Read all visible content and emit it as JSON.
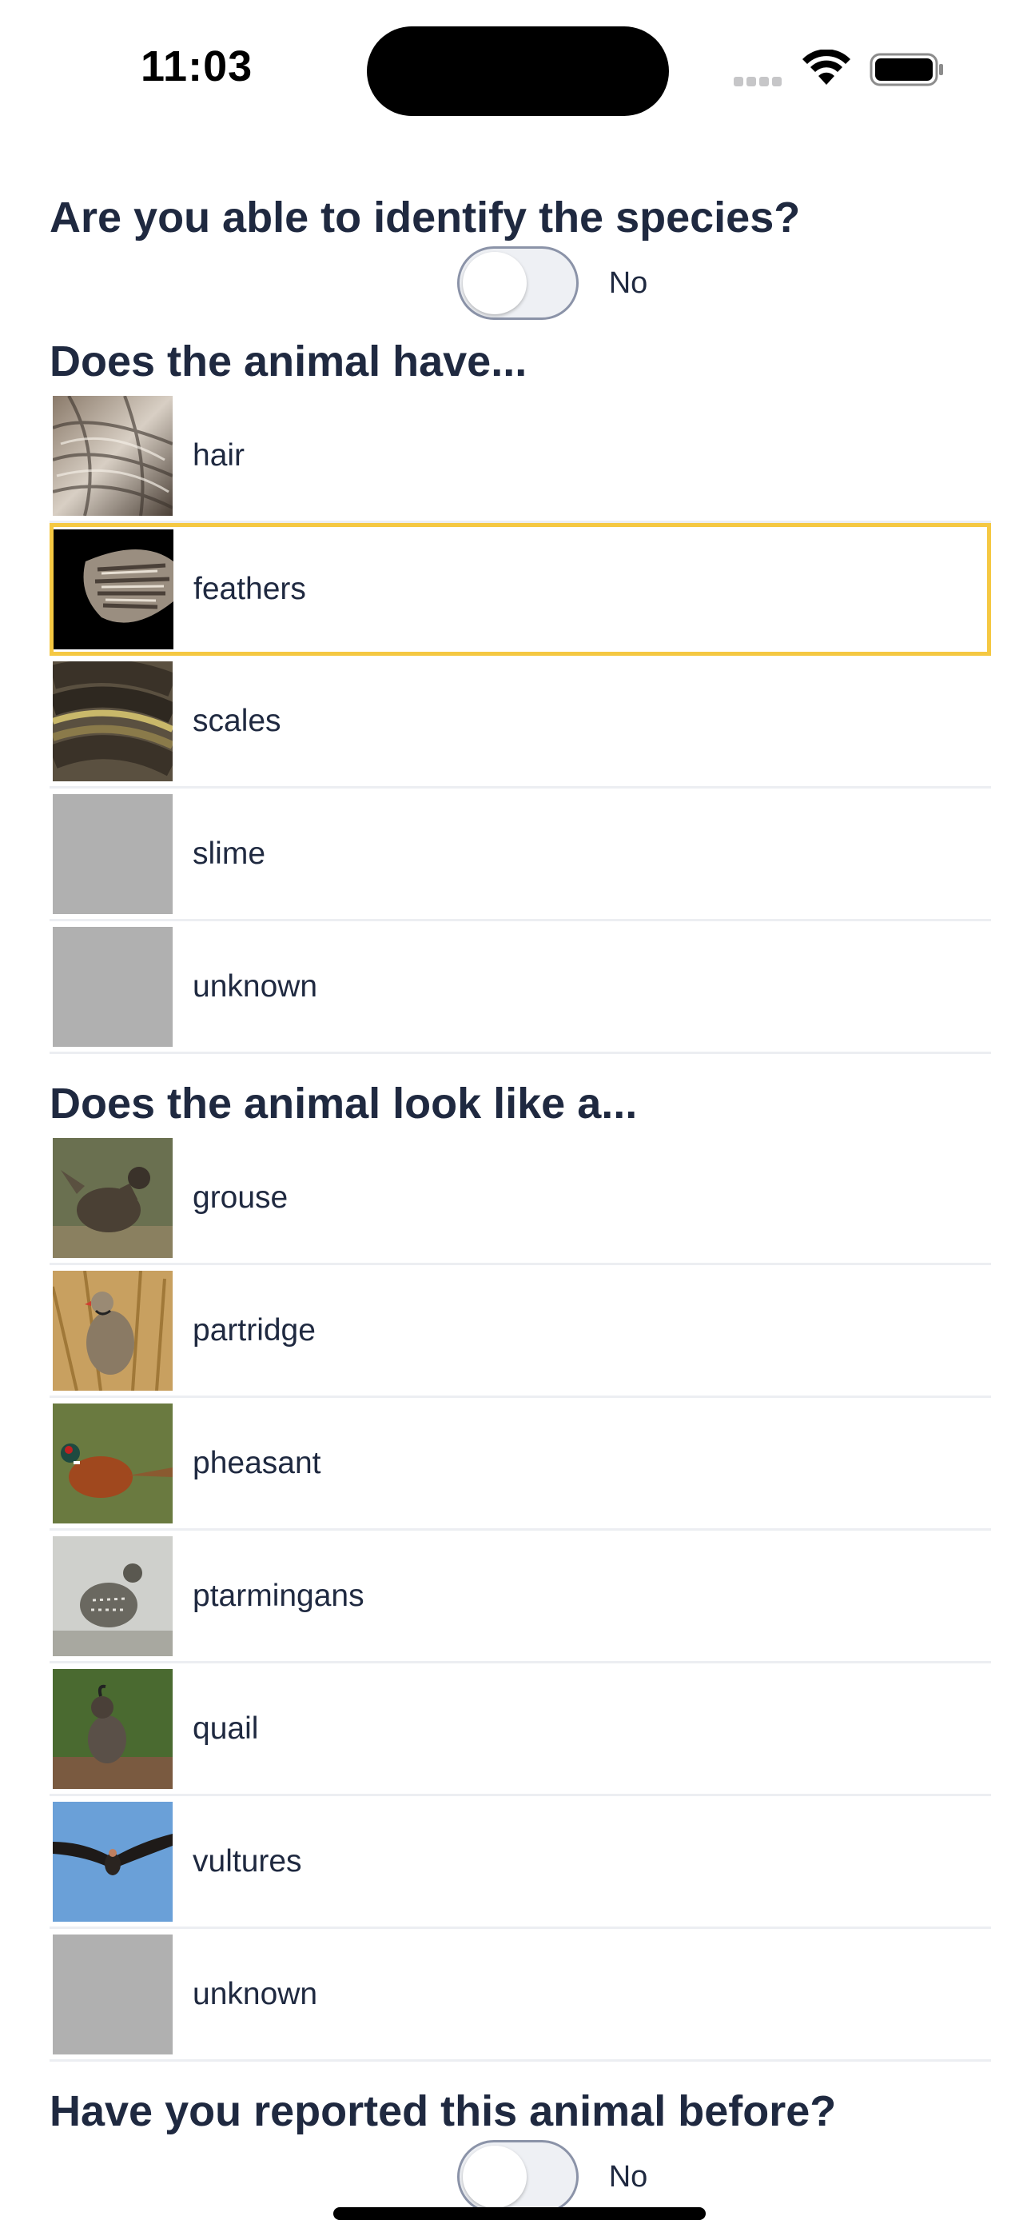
{
  "status_bar": {
    "time": "11:03"
  },
  "species_question": {
    "title": "Are you able to identify the species?",
    "toggle_label": "No"
  },
  "covering_section": {
    "title": "Does the animal have...",
    "items": [
      {
        "label": "hair",
        "thumb": "fur-photo",
        "selected": false
      },
      {
        "label": "feathers",
        "thumb": "wing-photo",
        "selected": true
      },
      {
        "label": "scales",
        "thumb": "snake-photo",
        "selected": false
      },
      {
        "label": "slime",
        "thumb": "placeholder",
        "selected": false
      },
      {
        "label": "unknown",
        "thumb": "placeholder",
        "selected": false
      }
    ]
  },
  "lookalike_section": {
    "title": "Does the animal look like a...",
    "items": [
      {
        "label": "grouse",
        "thumb": "grouse-photo"
      },
      {
        "label": "partridge",
        "thumb": "partridge-photo"
      },
      {
        "label": "pheasant",
        "thumb": "pheasant-photo"
      },
      {
        "label": "ptarmingans",
        "thumb": "ptarmigan-photo"
      },
      {
        "label": "quail",
        "thumb": "quail-photo"
      },
      {
        "label": "vultures",
        "thumb": "vulture-photo"
      },
      {
        "label": "unknown",
        "thumb": "placeholder"
      }
    ]
  },
  "reported_question": {
    "title": "Have you reported this animal before?",
    "toggle_label": "No"
  },
  "colors": {
    "selected_border": "#f5c842",
    "text": "#1f2940",
    "placeholder": "#b0b0b0"
  }
}
